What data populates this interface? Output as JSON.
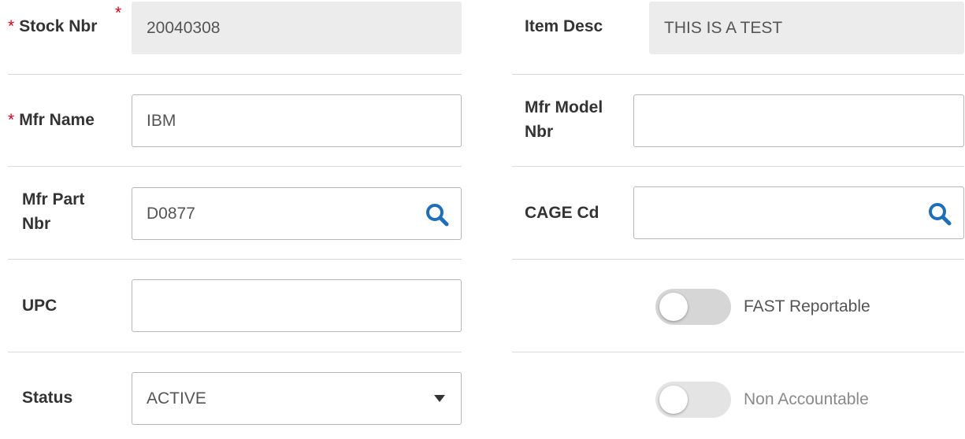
{
  "left": {
    "stock_nbr": {
      "label": "Stock Nbr",
      "value": "20040308",
      "required": "*"
    },
    "mfr_name": {
      "label": "Mfr Name",
      "value": "IBM",
      "required": "*"
    },
    "mfr_part_nbr": {
      "label_line1": "Mfr Part",
      "label_line2": "Nbr",
      "value": "D0877",
      "icon": "search-icon"
    },
    "upc": {
      "label": "UPC",
      "value": ""
    },
    "status": {
      "label": "Status",
      "value": "ACTIVE"
    }
  },
  "right": {
    "item_desc": {
      "label": "Item Desc",
      "value": "THIS IS A TEST"
    },
    "mfr_model_nbr": {
      "label_line1": "Mfr Model",
      "label_line2": "Nbr",
      "value": ""
    },
    "cage_cd": {
      "label": "CAGE Cd",
      "value": "",
      "icon": "search-icon"
    },
    "fast_reportable": {
      "label": "FAST Reportable",
      "checked": false
    },
    "non_accountable": {
      "label": "Non Accountable",
      "checked": false,
      "disabled": true
    }
  },
  "colors": {
    "required": "#d0021b",
    "search_icon": "#1e6fb8",
    "readonly_bg": "#ececec"
  }
}
